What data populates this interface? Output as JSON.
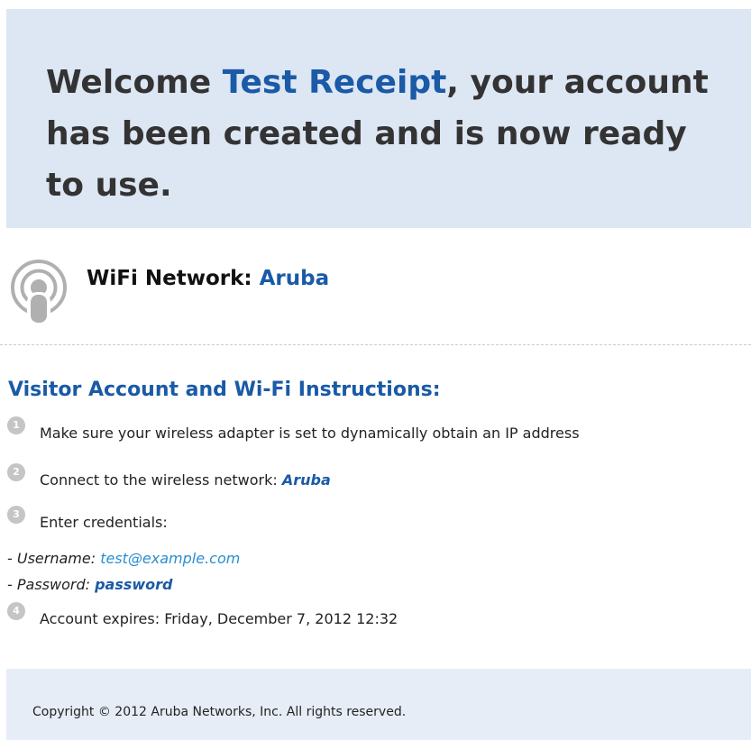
{
  "banner": {
    "prefix": "Welcome ",
    "name": "Test Receipt",
    "suffix": ", your account has been created and is now ready to use."
  },
  "network": {
    "icon": "wifi-broadcast-icon",
    "label": "WiFi Network: ",
    "ssid": "Aruba"
  },
  "instructions": {
    "title": "Visitor Account and Wi-Fi Instructions:",
    "steps": [
      {
        "number": "1",
        "text": "Make sure your wireless adapter is set to dynamically obtain an IP address",
        "value": ""
      },
      {
        "number": "2",
        "text": "Connect to the wireless network: ",
        "value": "Aruba"
      },
      {
        "number": "3",
        "text": "Enter credentials:",
        "value": ""
      },
      {
        "number": "4",
        "text": "Account expires: Friday, December 7, 2012 12:32",
        "value": ""
      }
    ],
    "credentials": {
      "username_label": "- Username: ",
      "username": "test@example.com",
      "password_label": "- Password: ",
      "password": "password"
    }
  },
  "footer": {
    "copyright": "Copyright © 2012 Aruba Networks, Inc. All rights reserved."
  },
  "colors": {
    "banner_bg": "#dde6f3",
    "accent": "#1a5aa6",
    "link": "#2a8fd0",
    "footer_bg": "#e7edf6"
  }
}
